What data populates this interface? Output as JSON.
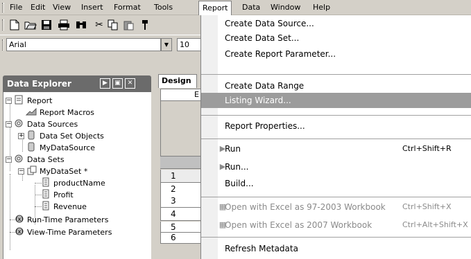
{
  "menubar": {
    "items": [
      {
        "label": "File",
        "u": "F"
      },
      {
        "label": "Edit",
        "u": "E"
      },
      {
        "label": "View",
        "u": "V"
      },
      {
        "label": "Insert",
        "u": "I"
      },
      {
        "label": "Format",
        "u": "m"
      },
      {
        "label": "Tools",
        "u": "T"
      },
      {
        "label": "Report",
        "u": "R"
      },
      {
        "label": "Data",
        "u": "D"
      },
      {
        "label": "Window",
        "u": "W"
      },
      {
        "label": "Help",
        "u": "H"
      }
    ]
  },
  "toolbar": {
    "font_name": "Arial",
    "font_size": "10"
  },
  "explorer": {
    "title": "Data Explorer",
    "tree": [
      {
        "label": "Report",
        "icon": "report-icon"
      },
      {
        "label": "Report Macros",
        "icon": "macro-icon"
      },
      {
        "label": "Data Sources",
        "icon": "data-sources-icon"
      },
      {
        "label": "Data Set Objects",
        "icon": "dataset-objects-icon"
      },
      {
        "label": "MyDataSource",
        "icon": "datasource-icon"
      },
      {
        "label": "Data Sets",
        "icon": "datasets-icon"
      },
      {
        "label": "MyDataSet *",
        "icon": "dataset-icon"
      },
      {
        "label": "productName",
        "icon": "field-icon"
      },
      {
        "label": "Profit",
        "icon": "field-icon"
      },
      {
        "label": "Revenue",
        "icon": "field-icon"
      },
      {
        "label": "Run-Time Parameters",
        "icon": "parameters-icon"
      },
      {
        "label": "View-Time Parameters",
        "icon": "parameters-icon"
      }
    ]
  },
  "design": {
    "tab_label": "Design",
    "column_header": "E",
    "row_numbers": [
      "1",
      "2",
      "3",
      "4",
      "5",
      "6"
    ]
  },
  "report_menu": {
    "items": [
      {
        "label": "Create Data Source...",
        "shortcut": ""
      },
      {
        "label": "Create Data Set...",
        "shortcut": ""
      },
      {
        "label": "Create Report Parameter...",
        "shortcut": ""
      },
      {
        "label": "Create Data Range",
        "shortcut": ""
      },
      {
        "label": "Listing Wizard...",
        "shortcut": ""
      },
      {
        "label": "Report Properties...",
        "shortcut": ""
      },
      {
        "label": "Run",
        "shortcut": "Ctrl+Shift+R"
      },
      {
        "label": "Run...",
        "shortcut": ""
      },
      {
        "label": "Build...",
        "shortcut": ""
      },
      {
        "label": "Open with Excel as 97-2003 Workbook",
        "shortcut": "Ctrl+Shift+X"
      },
      {
        "label": "Open with Excel as 2007 Workbook",
        "shortcut": "Ctrl+Alt+Shift+X"
      },
      {
        "label": "Refresh Metadata",
        "shortcut": ""
      }
    ]
  }
}
